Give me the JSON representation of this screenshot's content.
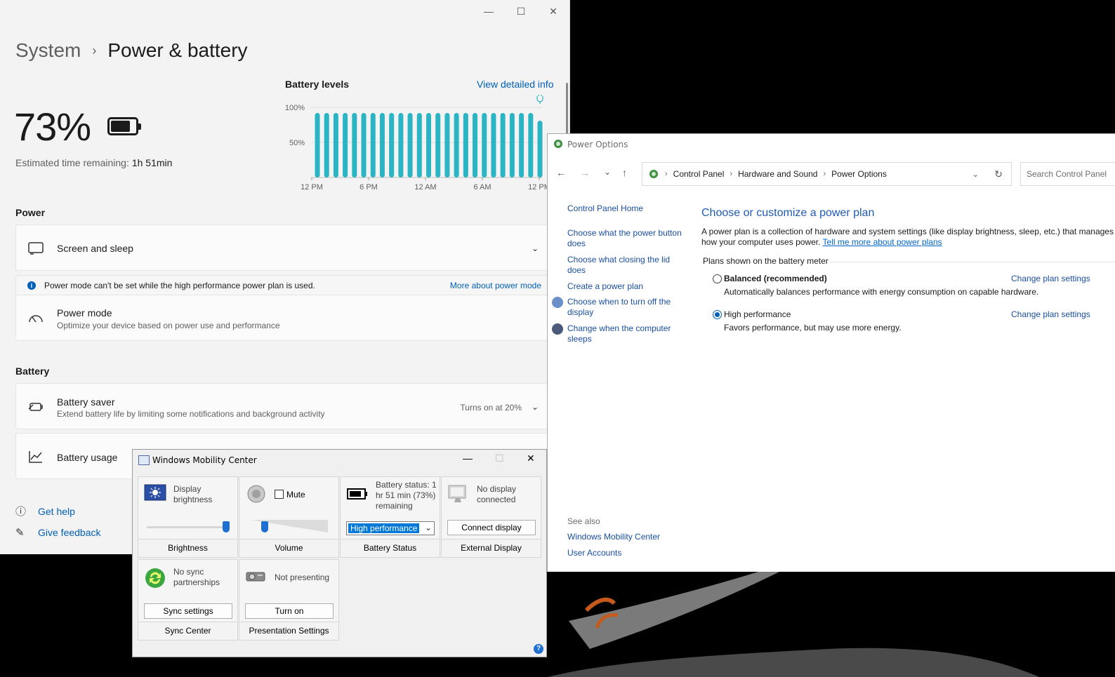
{
  "settings": {
    "window_controls": {
      "minimize": "—",
      "maximize": "☐",
      "close": "✕"
    },
    "breadcrumb": {
      "parent": "System",
      "separator": "›",
      "current": "Power & battery"
    },
    "battery_percent": "73%",
    "estimated_label": "Estimated time remaining:",
    "estimated_value": "1h 51min",
    "battery_levels_title": "Battery levels",
    "view_detailed_info": "View detailed info",
    "power_section": "Power",
    "screen_and_sleep": "Screen and sleep",
    "info_message": "Power mode can't be set while the high performance power plan is used.",
    "info_link": "More about power mode",
    "power_mode_title": "Power mode",
    "power_mode_desc": "Optimize your device based on power use and performance",
    "battery_section": "Battery",
    "battery_saver_title": "Battery saver",
    "battery_saver_desc": "Extend battery life by limiting some notifications and background activity",
    "battery_saver_status": "Turns on at 20%",
    "battery_usage": "Battery usage",
    "get_help": "Get help",
    "give_feedback": "Give feedback"
  },
  "chart_data": {
    "type": "bar",
    "title": "Battery levels",
    "y_ticks": [
      "100%",
      "50%"
    ],
    "x_ticks": [
      "12 PM",
      "6 PM",
      "12 AM",
      "6 AM",
      "12 PM"
    ],
    "ylim": [
      0,
      100
    ],
    "values": [
      92,
      92,
      92,
      92,
      92,
      92,
      92,
      92,
      92,
      92,
      92,
      92,
      92,
      92,
      92,
      92,
      92,
      92,
      92,
      92,
      92,
      92,
      92,
      92,
      81
    ],
    "charging_indicator": "plug-icon",
    "bar_color": "#2bb5c4"
  },
  "power_options": {
    "title": "Power Options",
    "nav": {
      "back": "←",
      "forward": "→",
      "recent": "⌄",
      "up": "↑"
    },
    "address": [
      "Control Panel",
      "Hardware and Sound",
      "Power Options"
    ],
    "address_sep": "›",
    "search_placeholder": "Search Control Panel",
    "left_links": {
      "home": "Control Panel Home",
      "power_button": "Choose what the power button does",
      "closing_lid": "Choose what closing the lid does",
      "create_plan": "Create a power plan",
      "turn_off_display": "Choose when to turn off the display",
      "sleep": "Change when the computer sleeps"
    },
    "heading": "Choose or customize a power plan",
    "description": "A power plan is a collection of hardware and system settings (like display brightness, sleep, etc.) that manages",
    "description_2": "how your computer uses power.",
    "tell_me_more": "Tell me more about power plans",
    "plans_label": "Plans shown on the battery meter",
    "plans": [
      {
        "name": "Balanced (recommended)",
        "desc": "Automatically balances performance with energy consumption on capable hardware.",
        "action": "Change plan settings",
        "selected": false
      },
      {
        "name": "High performance",
        "desc": "Favors performance, but may use more energy.",
        "action": "Change plan settings",
        "selected": true
      }
    ],
    "see_also": "See also",
    "see_also_links": [
      "Windows Mobility Center",
      "User Accounts"
    ]
  },
  "mobility_center": {
    "title": "Windows Mobility Center",
    "brightness": {
      "label": "Display brightness",
      "caption": "Brightness",
      "level": 1.0
    },
    "volume": {
      "mute": "Mute",
      "caption": "Volume",
      "level": 0.15
    },
    "battery": {
      "status": "Battery status: 1 hr 51 min (73%) remaining",
      "plan": "High performance",
      "caption": "Battery Status"
    },
    "display": {
      "status": "No display connected",
      "button": "Connect display",
      "caption": "External Display"
    },
    "sync": {
      "status": "No sync partnerships",
      "button": "Sync settings",
      "caption": "Sync Center"
    },
    "presentation": {
      "status": "Not presenting",
      "button": "Turn on",
      "caption": "Presentation Settings"
    },
    "help": "?"
  }
}
